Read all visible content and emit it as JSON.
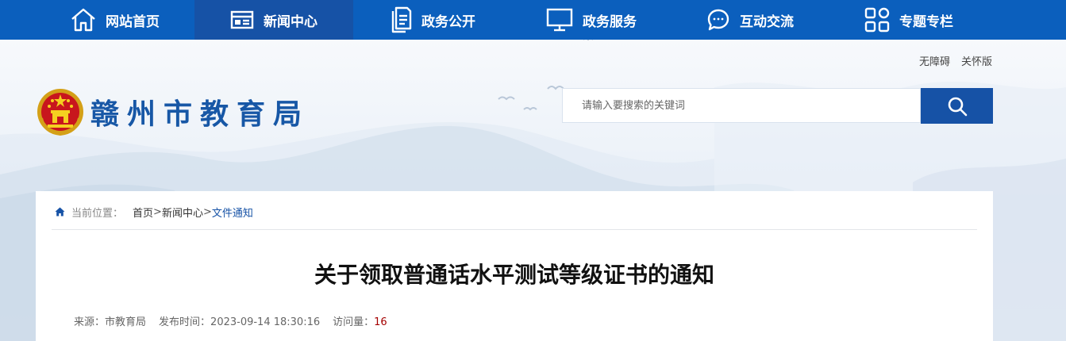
{
  "nav": {
    "items": [
      {
        "label": "网站首页",
        "icon": "home-icon"
      },
      {
        "label": "新闻中心",
        "icon": "news-icon",
        "active": true
      },
      {
        "label": "政务公开",
        "icon": "document-icon"
      },
      {
        "label": "政务服务",
        "icon": "monitor-icon"
      },
      {
        "label": "互动交流",
        "icon": "chat-icon"
      },
      {
        "label": "专题专栏",
        "icon": "grid-icon"
      }
    ]
  },
  "header": {
    "util_links": [
      "无障碍",
      "关怀版"
    ],
    "site_title": "赣州市教育局",
    "search_placeholder": "请输入要搜索的关键词"
  },
  "breadcrumb": {
    "prefix": "当前位置：",
    "items": [
      "首页",
      "新闻中心",
      "文件通知"
    ],
    "separator": ">"
  },
  "article": {
    "title": "关于领取普通话水平测试等级证书的通知",
    "source_label": "来源：",
    "source": "市教育局",
    "time_label": "发布时间：",
    "time": "2023-09-14 18:30:16",
    "views_label": "访问量：",
    "views": "16"
  },
  "colors": {
    "nav_bg": "#0b5fbd",
    "nav_active": "#1652a6",
    "title_blue": "#1757a6",
    "views_red": "#a40000"
  }
}
